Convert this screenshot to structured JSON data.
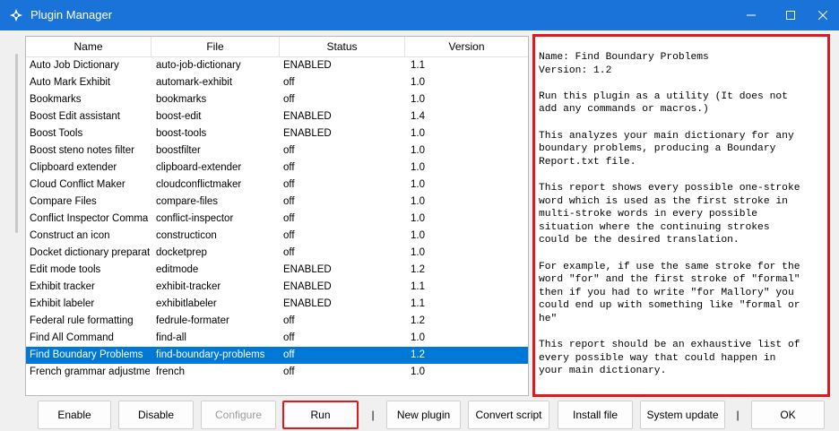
{
  "window": {
    "title": "Plugin Manager"
  },
  "colors": {
    "titlebar": "#1a73d9",
    "selection": "#0078d7",
    "highlight": "#e0191e"
  },
  "table": {
    "headers": [
      "Name",
      "File",
      "Status",
      "Version"
    ],
    "selected_index": 17,
    "rows": [
      [
        "Auto Job Dictionary",
        "auto-job-dictionary",
        "ENABLED",
        "1.1"
      ],
      [
        "Auto Mark Exhibit",
        "automark-exhibit",
        "off",
        "1.0"
      ],
      [
        "Bookmarks",
        "bookmarks",
        "off",
        "1.0"
      ],
      [
        "Boost Edit assistant",
        "boost-edit",
        "ENABLED",
        "1.4"
      ],
      [
        "Boost Tools",
        "boost-tools",
        "ENABLED",
        "1.0"
      ],
      [
        "Boost steno notes filter",
        "boostfilter",
        "off",
        "1.0"
      ],
      [
        "Clipboard extender",
        "clipboard-extender",
        "off",
        "1.0"
      ],
      [
        "Cloud Conflict Maker",
        "cloudconflictmaker",
        "off",
        "1.0"
      ],
      [
        "Compare Files",
        "compare-files",
        "off",
        "1.0"
      ],
      [
        "Conflict Inspector Comma",
        "conflict-inspector",
        "off",
        "1.0"
      ],
      [
        "Construct an icon",
        "constructicon",
        "off",
        "1.0"
      ],
      [
        "Docket dictionary preparati",
        "docketprep",
        "off",
        "1.0"
      ],
      [
        "Edit mode tools",
        "editmode",
        "ENABLED",
        "1.2"
      ],
      [
        "Exhibit tracker",
        "exhibit-tracker",
        "ENABLED",
        "1.1"
      ],
      [
        "Exhibit labeler",
        "exhibitlabeler",
        "ENABLED",
        "1.1"
      ],
      [
        "Federal rule formatting",
        "fedrule-formater",
        "off",
        "1.2"
      ],
      [
        "Find All Command",
        "find-all",
        "off",
        "1.0"
      ],
      [
        "Find Boundary Problems",
        "find-boundary-problems",
        "off",
        "1.2"
      ],
      [
        "French grammar adjustmei",
        "french",
        "off",
        "1.0"
      ]
    ]
  },
  "description": {
    "text": "Name: Find Boundary Problems\nVersion: 1.2\n\nRun this plugin as a utility (It does not\nadd any commands or macros.)\n\nThis analyzes your main dictionary for any\nboundary problems, producing a Boundary\nReport.txt file.\n\nThis report shows every possible one-stroke\nword which is used as the first stroke in\nmulti-stroke words in every possible\nsituation where the continuing strokes\ncould be the desired translation.\n\nFor example, if use the same stroke for the\nword \"for\" and the first stroke of \"formal\"\nthen if you had to write \"for Mallory\" you\ncould end up with something like \"formal or\nhe\"\n\nThis report should be an exhaustive list of\nevery possible way that could happen in\nyour main dictionary."
  },
  "buttons": {
    "enable": "Enable",
    "disable": "Disable",
    "configure": "Configure",
    "run": "Run",
    "sep": "|",
    "new_plugin": "New plugin",
    "convert_script": "Convert script",
    "install_file": "Install file",
    "system_update": "System update",
    "ok": "OK"
  }
}
